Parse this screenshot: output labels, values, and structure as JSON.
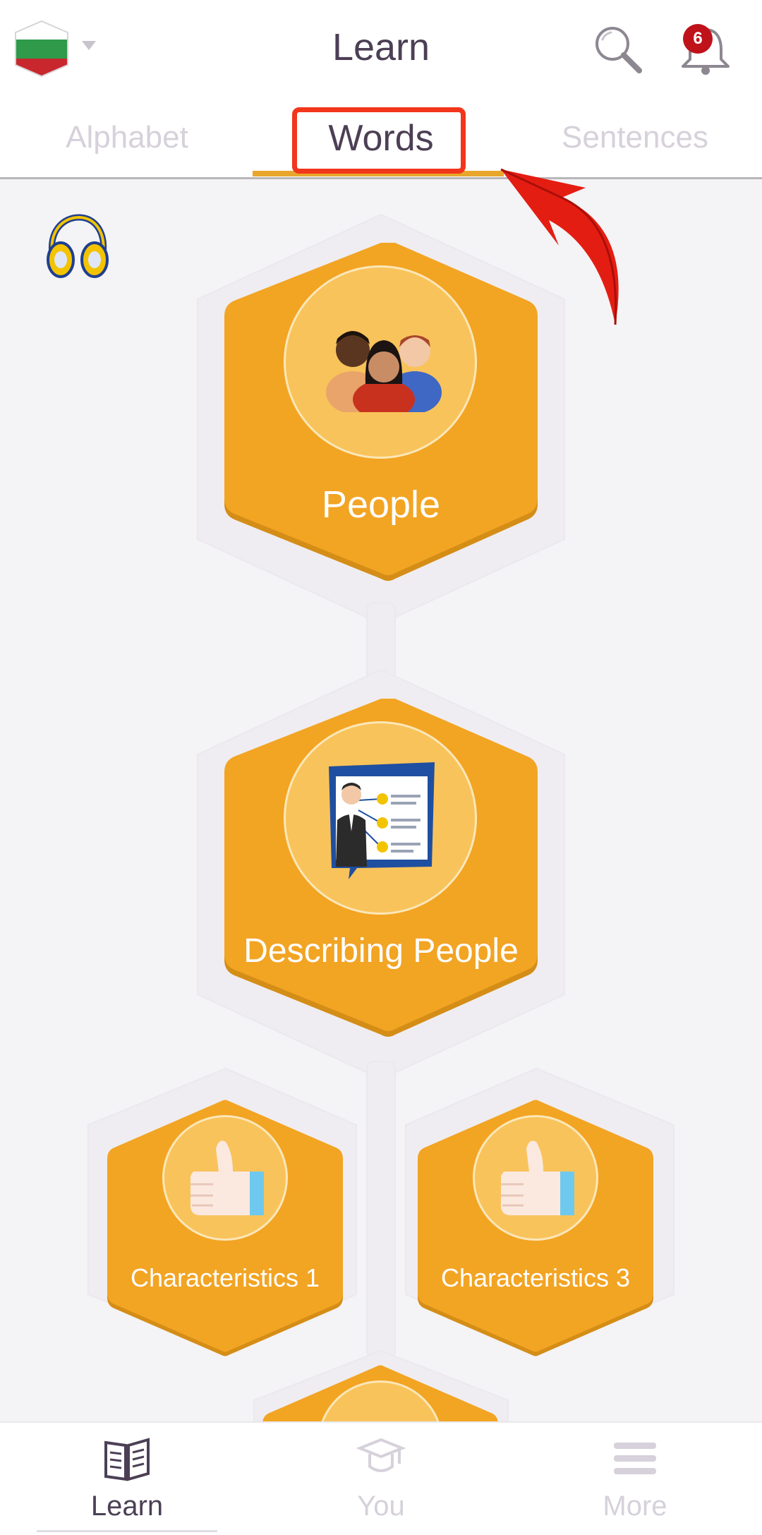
{
  "header": {
    "title": "Learn",
    "notification_count": "6",
    "language_flag": "bulgaria-flag-icon"
  },
  "tabs": [
    {
      "label": "Alphabet",
      "active": false
    },
    {
      "label": "Words",
      "active": true
    },
    {
      "label": "Sentences",
      "active": false
    }
  ],
  "lessons": {
    "people": {
      "label": "People",
      "icon": "people-group-icon"
    },
    "describing_people": {
      "label": "Describing People",
      "icon": "presentation-board-icon"
    },
    "characteristics_1": {
      "label": "Characteristics 1",
      "icon": "thumbs-up-icon"
    },
    "characteristics_3": {
      "label": "Characteristics 3",
      "icon": "thumbs-up-icon"
    }
  },
  "bottom_nav": [
    {
      "label": "Learn",
      "icon": "book-icon",
      "active": true
    },
    {
      "label": "You",
      "icon": "graduation-cap-icon",
      "active": false
    },
    {
      "label": "More",
      "icon": "menu-lines-icon",
      "active": false
    }
  ],
  "colors": {
    "accent": "#f2a423",
    "hex_fill": "#f2a423",
    "text_dark": "#4c3f55",
    "text_muted": "#d6d1da",
    "badge": "#c0121b",
    "highlight": "#f2361c"
  }
}
